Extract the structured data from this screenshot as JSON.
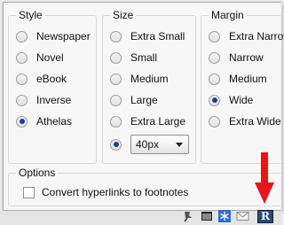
{
  "groups": {
    "style": {
      "title": "Style",
      "options": [
        "Newspaper",
        "Novel",
        "eBook",
        "Inverse",
        "Athelas"
      ],
      "selected": "Athelas"
    },
    "size": {
      "title": "Size",
      "options": [
        "Extra Small",
        "Small",
        "Medium",
        "Large",
        "Extra Large"
      ],
      "custom_value": "40px",
      "selected": "custom"
    },
    "margin": {
      "title": "Margin",
      "options": [
        "Extra Narrow",
        "Narrow",
        "Medium",
        "Wide",
        "Extra Wide"
      ],
      "selected": "Wide"
    },
    "options": {
      "title": "Options",
      "checkbox_label": "Convert hyperlinks to footnotes",
      "checked": false
    }
  },
  "tray": {
    "icons": [
      "pin-icon",
      "window-icon",
      "snowflake-icon",
      "mail-icon",
      "readability-icon"
    ],
    "readability_glyph": "R"
  },
  "annotation": {
    "arrow_color": "#e8151b",
    "points_to": "readability-icon"
  },
  "colors": {
    "radio_selected": "#1c3f8a",
    "tray_highlight": "#2a4a7c"
  }
}
